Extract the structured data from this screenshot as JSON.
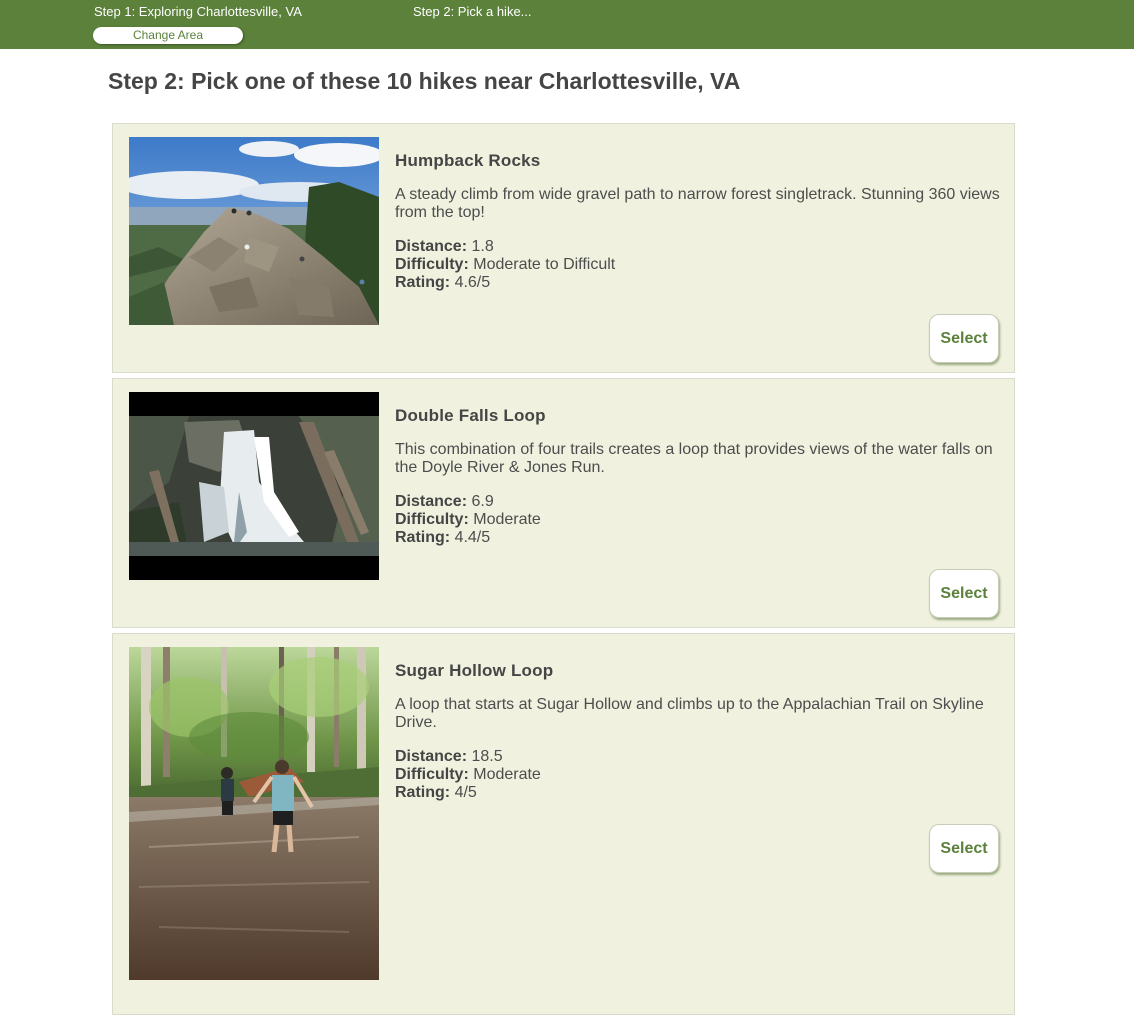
{
  "header": {
    "step1": "Step 1: Exploring Charlottesville, VA",
    "step2": "Step 2: Pick a hike...",
    "change_area": "Change Area",
    "accent": "#5b813b"
  },
  "page_title": "Step 2: Pick one of these 10 hikes near Charlottesville, VA",
  "labels": {
    "distance": "Distance:",
    "difficulty": "Difficulty:",
    "rating": "Rating:",
    "select": "Select"
  },
  "hikes": [
    {
      "name": "Humpback Rocks",
      "description": "A steady climb from wide gravel path to narrow forest singletrack. Stunning 360 views from the top!",
      "distance": "1.8",
      "difficulty": "Moderate to Difficult",
      "rating": "4.6/5",
      "image": "rocky-summit-photo"
    },
    {
      "name": "Double Falls Loop",
      "description": "This combination of four trails creates a loop that provides views of the water falls on the Doyle River & Jones Run.",
      "distance": "6.9",
      "difficulty": "Moderate",
      "rating": "4.4/5",
      "image": "waterfall-photo"
    },
    {
      "name": "Sugar Hollow Loop",
      "description": "A loop that starts at Sugar Hollow and climbs up to the Appalachian Trail on Skyline Drive.",
      "distance": "18.5",
      "difficulty": "Moderate",
      "rating": "4/5",
      "image": "river-crossing-photo"
    }
  ]
}
